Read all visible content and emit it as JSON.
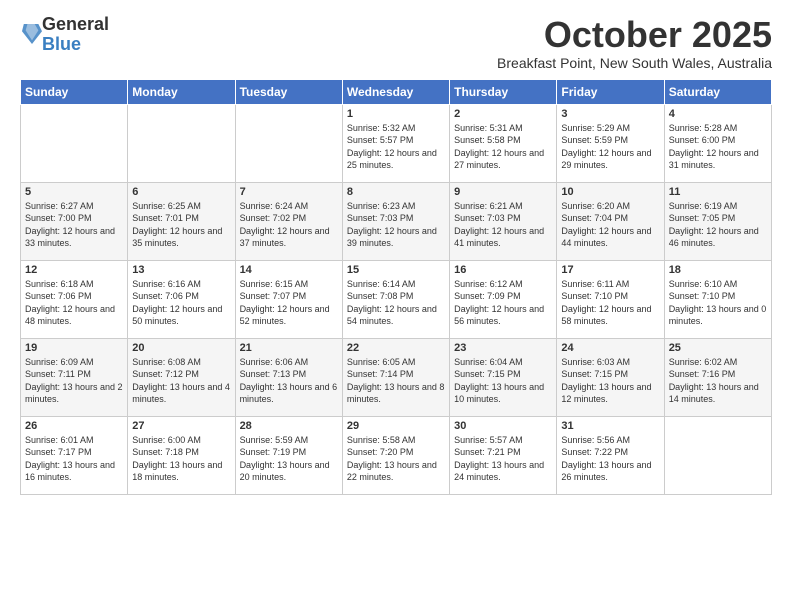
{
  "header": {
    "logo": {
      "general": "General",
      "blue": "Blue"
    },
    "title": "October 2025",
    "subtitle": "Breakfast Point, New South Wales, Australia"
  },
  "days_of_week": [
    "Sunday",
    "Monday",
    "Tuesday",
    "Wednesday",
    "Thursday",
    "Friday",
    "Saturday"
  ],
  "weeks": [
    {
      "cells": [
        {
          "empty": true
        },
        {
          "empty": true
        },
        {
          "empty": true
        },
        {
          "day": 1,
          "sunrise": "5:32 AM",
          "sunset": "5:57 PM",
          "daylight": "12 hours and 25 minutes."
        },
        {
          "day": 2,
          "sunrise": "5:31 AM",
          "sunset": "5:58 PM",
          "daylight": "12 hours and 27 minutes."
        },
        {
          "day": 3,
          "sunrise": "5:29 AM",
          "sunset": "5:59 PM",
          "daylight": "12 hours and 29 minutes."
        },
        {
          "day": 4,
          "sunrise": "5:28 AM",
          "sunset": "6:00 PM",
          "daylight": "12 hours and 31 minutes."
        }
      ]
    },
    {
      "cells": [
        {
          "day": 5,
          "sunrise": "6:27 AM",
          "sunset": "7:00 PM",
          "daylight": "12 hours and 33 minutes."
        },
        {
          "day": 6,
          "sunrise": "6:25 AM",
          "sunset": "7:01 PM",
          "daylight": "12 hours and 35 minutes."
        },
        {
          "day": 7,
          "sunrise": "6:24 AM",
          "sunset": "7:02 PM",
          "daylight": "12 hours and 37 minutes."
        },
        {
          "day": 8,
          "sunrise": "6:23 AM",
          "sunset": "7:03 PM",
          "daylight": "12 hours and 39 minutes."
        },
        {
          "day": 9,
          "sunrise": "6:21 AM",
          "sunset": "7:03 PM",
          "daylight": "12 hours and 41 minutes."
        },
        {
          "day": 10,
          "sunrise": "6:20 AM",
          "sunset": "7:04 PM",
          "daylight": "12 hours and 44 minutes."
        },
        {
          "day": 11,
          "sunrise": "6:19 AM",
          "sunset": "7:05 PM",
          "daylight": "12 hours and 46 minutes."
        }
      ]
    },
    {
      "cells": [
        {
          "day": 12,
          "sunrise": "6:18 AM",
          "sunset": "7:06 PM",
          "daylight": "12 hours and 48 minutes."
        },
        {
          "day": 13,
          "sunrise": "6:16 AM",
          "sunset": "7:06 PM",
          "daylight": "12 hours and 50 minutes."
        },
        {
          "day": 14,
          "sunrise": "6:15 AM",
          "sunset": "7:07 PM",
          "daylight": "12 hours and 52 minutes."
        },
        {
          "day": 15,
          "sunrise": "6:14 AM",
          "sunset": "7:08 PM",
          "daylight": "12 hours and 54 minutes."
        },
        {
          "day": 16,
          "sunrise": "6:12 AM",
          "sunset": "7:09 PM",
          "daylight": "12 hours and 56 minutes."
        },
        {
          "day": 17,
          "sunrise": "6:11 AM",
          "sunset": "7:10 PM",
          "daylight": "12 hours and 58 minutes."
        },
        {
          "day": 18,
          "sunrise": "6:10 AM",
          "sunset": "7:10 PM",
          "daylight": "13 hours and 0 minutes."
        }
      ]
    },
    {
      "cells": [
        {
          "day": 19,
          "sunrise": "6:09 AM",
          "sunset": "7:11 PM",
          "daylight": "13 hours and 2 minutes."
        },
        {
          "day": 20,
          "sunrise": "6:08 AM",
          "sunset": "7:12 PM",
          "daylight": "13 hours and 4 minutes."
        },
        {
          "day": 21,
          "sunrise": "6:06 AM",
          "sunset": "7:13 PM",
          "daylight": "13 hours and 6 minutes."
        },
        {
          "day": 22,
          "sunrise": "6:05 AM",
          "sunset": "7:14 PM",
          "daylight": "13 hours and 8 minutes."
        },
        {
          "day": 23,
          "sunrise": "6:04 AM",
          "sunset": "7:15 PM",
          "daylight": "13 hours and 10 minutes."
        },
        {
          "day": 24,
          "sunrise": "6:03 AM",
          "sunset": "7:15 PM",
          "daylight": "13 hours and 12 minutes."
        },
        {
          "day": 25,
          "sunrise": "6:02 AM",
          "sunset": "7:16 PM",
          "daylight": "13 hours and 14 minutes."
        }
      ]
    },
    {
      "cells": [
        {
          "day": 26,
          "sunrise": "6:01 AM",
          "sunset": "7:17 PM",
          "daylight": "13 hours and 16 minutes."
        },
        {
          "day": 27,
          "sunrise": "6:00 AM",
          "sunset": "7:18 PM",
          "daylight": "13 hours and 18 minutes."
        },
        {
          "day": 28,
          "sunrise": "5:59 AM",
          "sunset": "7:19 PM",
          "daylight": "13 hours and 20 minutes."
        },
        {
          "day": 29,
          "sunrise": "5:58 AM",
          "sunset": "7:20 PM",
          "daylight": "13 hours and 22 minutes."
        },
        {
          "day": 30,
          "sunrise": "5:57 AM",
          "sunset": "7:21 PM",
          "daylight": "13 hours and 24 minutes."
        },
        {
          "day": 31,
          "sunrise": "5:56 AM",
          "sunset": "7:22 PM",
          "daylight": "13 hours and 26 minutes."
        },
        {
          "empty": true
        }
      ]
    }
  ],
  "labels": {
    "sunrise_prefix": "Sunrise: ",
    "sunset_prefix": "Sunset: ",
    "daylight_prefix": "Daylight: "
  }
}
